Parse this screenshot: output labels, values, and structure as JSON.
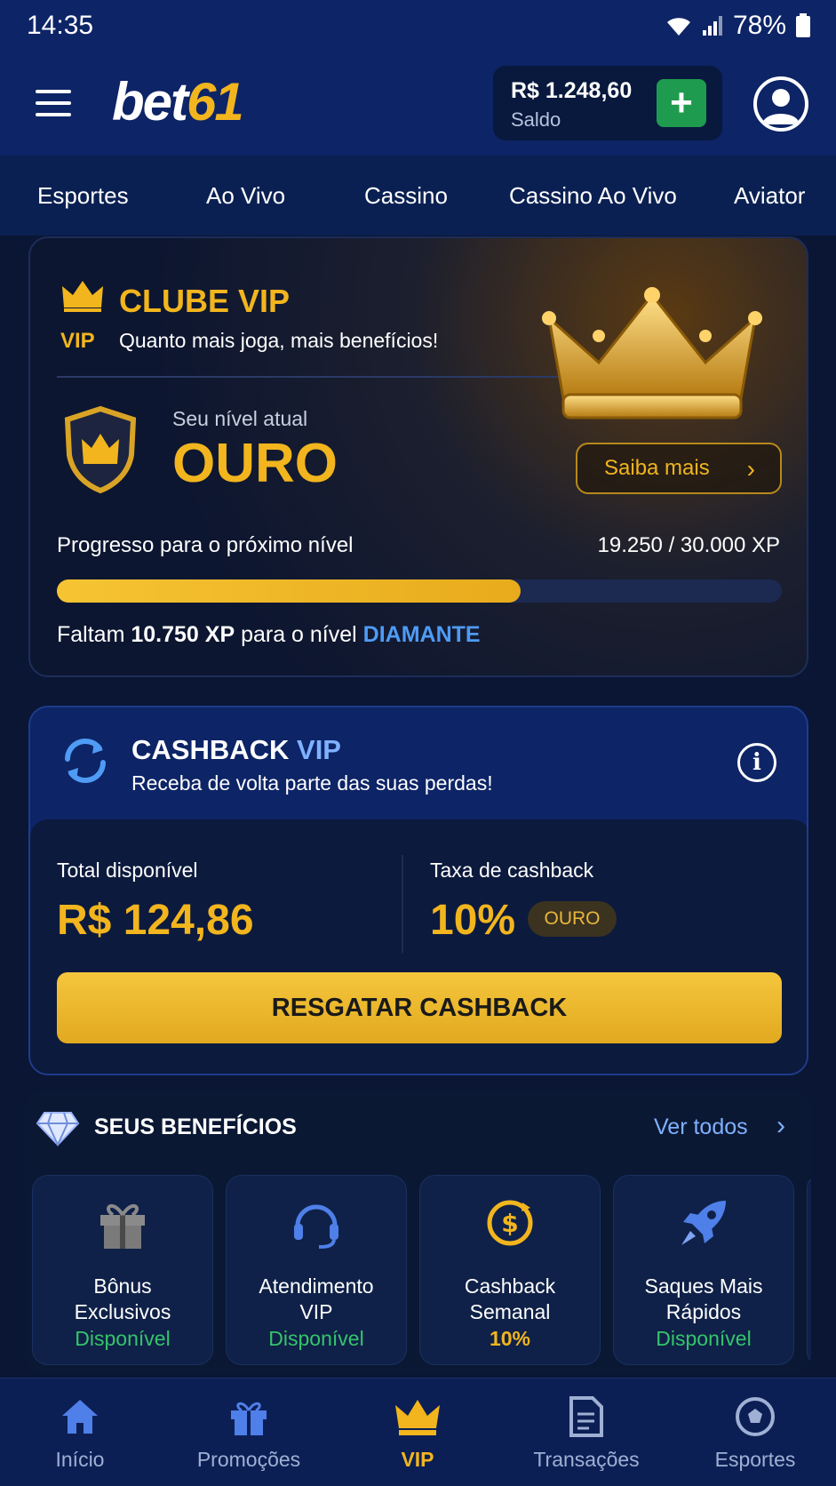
{
  "status": {
    "time": "14:35",
    "battery": "78%"
  },
  "header": {
    "logo_main": "bet",
    "logo_accent": "61",
    "balance_value": "R$ 1.248,60",
    "balance_label": "Saldo",
    "deposit_symbol": "+"
  },
  "nav_tabs": [
    "Esportes",
    "Ao Vivo",
    "Cassino",
    "Cassino Ao Vivo",
    "Aviator"
  ],
  "vip": {
    "badge": "VIP",
    "title": "CLUBE VIP",
    "subtitle": "Quanto mais joga, mais benefícios!",
    "level_label": "Seu nível atual",
    "level_value": "OURO",
    "learn_more": "Saiba mais",
    "progress_label": "Progresso para o próximo nível",
    "progress_value": "19.250 / 30.000 XP",
    "progress_fraction": 0.64,
    "remaining_prefix": "Faltam ",
    "remaining_xp": "10.750 XP",
    "remaining_mid": " para o nível ",
    "next_level": "DIAMANTE"
  },
  "cashback": {
    "title_main": "CASHBACK",
    "title_accent": "VIP",
    "subtitle": "Receba de volta parte das suas perdas!",
    "info_symbol": "i",
    "total_label": "Total disponível",
    "total_value": "R$ 124,86",
    "rate_label": "Taxa de cashback",
    "rate_value": "10%",
    "rate_badge": "OURO",
    "redeem_button": "RESGATAR CASHBACK"
  },
  "benefits": {
    "title": "SEUS BENEFÍCIOS",
    "view_all": "Ver todos",
    "items": [
      {
        "name_line1": "Bônus",
        "name_line2": "Exclusivos",
        "status": "Disponível",
        "icon": "gift-icon"
      },
      {
        "name_line1": "Atendimento",
        "name_line2": "VIP",
        "status": "Disponível",
        "icon": "headset-icon"
      },
      {
        "name_line1": "Cashback",
        "name_line2": "Semanal",
        "status": "10%",
        "icon": "dollar-cycle-icon"
      },
      {
        "name_line1": "Saques Mais",
        "name_line2": "Rápidos",
        "status": "Disponível",
        "icon": "rocket-icon"
      }
    ]
  },
  "bottom_nav": [
    {
      "label": "Início",
      "icon": "home-icon"
    },
    {
      "label": "Promoções",
      "icon": "gift-icon"
    },
    {
      "label": "VIP",
      "icon": "crown-icon",
      "active": true
    },
    {
      "label": "Transações",
      "icon": "document-icon"
    },
    {
      "label": "Esportes",
      "icon": "soccer-ball-icon"
    }
  ],
  "colors": {
    "gold": "#f2b51e",
    "navy": "#0d2466",
    "background": "#0a1634",
    "green": "#35c46b",
    "blue_accent": "#4f9bf5"
  }
}
